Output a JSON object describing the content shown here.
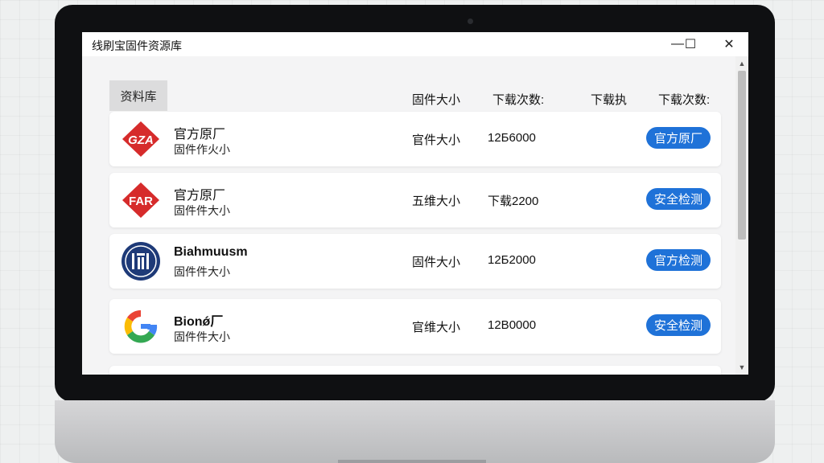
{
  "window": {
    "title": "线刷宝固件资源库",
    "minimize_glyph": "—",
    "maximize_glyph": "☐",
    "close_glyph": "✕"
  },
  "tab": {
    "label": "资料库"
  },
  "columns": {
    "size": "固件大小",
    "downloads": "下载次数:",
    "download_action": "下载执",
    "downloads_2": "下载次数:"
  },
  "rows": [
    {
      "logo_text": "GZA",
      "logo_icon": "red-diamond-logo",
      "name": "官方原厂",
      "subtitle": "固件作火小",
      "size": "官件大小",
      "count": "12Б6000",
      "action": "官方原厂"
    },
    {
      "logo_text": "FAR",
      "logo_icon": "red-diamond-logo",
      "name": "官方原厂",
      "subtitle": "固件件大小",
      "size": "五维大小",
      "count": "下载2200",
      "action": "安全检测"
    },
    {
      "logo_text": "",
      "logo_icon": "blue-circle-logo",
      "name": "Biahmuusm",
      "subtitle": "固件件大小",
      "size": "固件大小",
      "count": "12Б2000",
      "action": "官方检测"
    },
    {
      "logo_text": "G",
      "logo_icon": "google-g-logo",
      "name": "Bionǿ厂",
      "subtitle": "固件件大小",
      "size": "官维大小",
      "count": "12B0000",
      "action": "安全检测"
    }
  ],
  "colors": {
    "accent": "#1f72d8",
    "logo_red": "#d62b2b",
    "logo_navy": "#1e3a78"
  }
}
